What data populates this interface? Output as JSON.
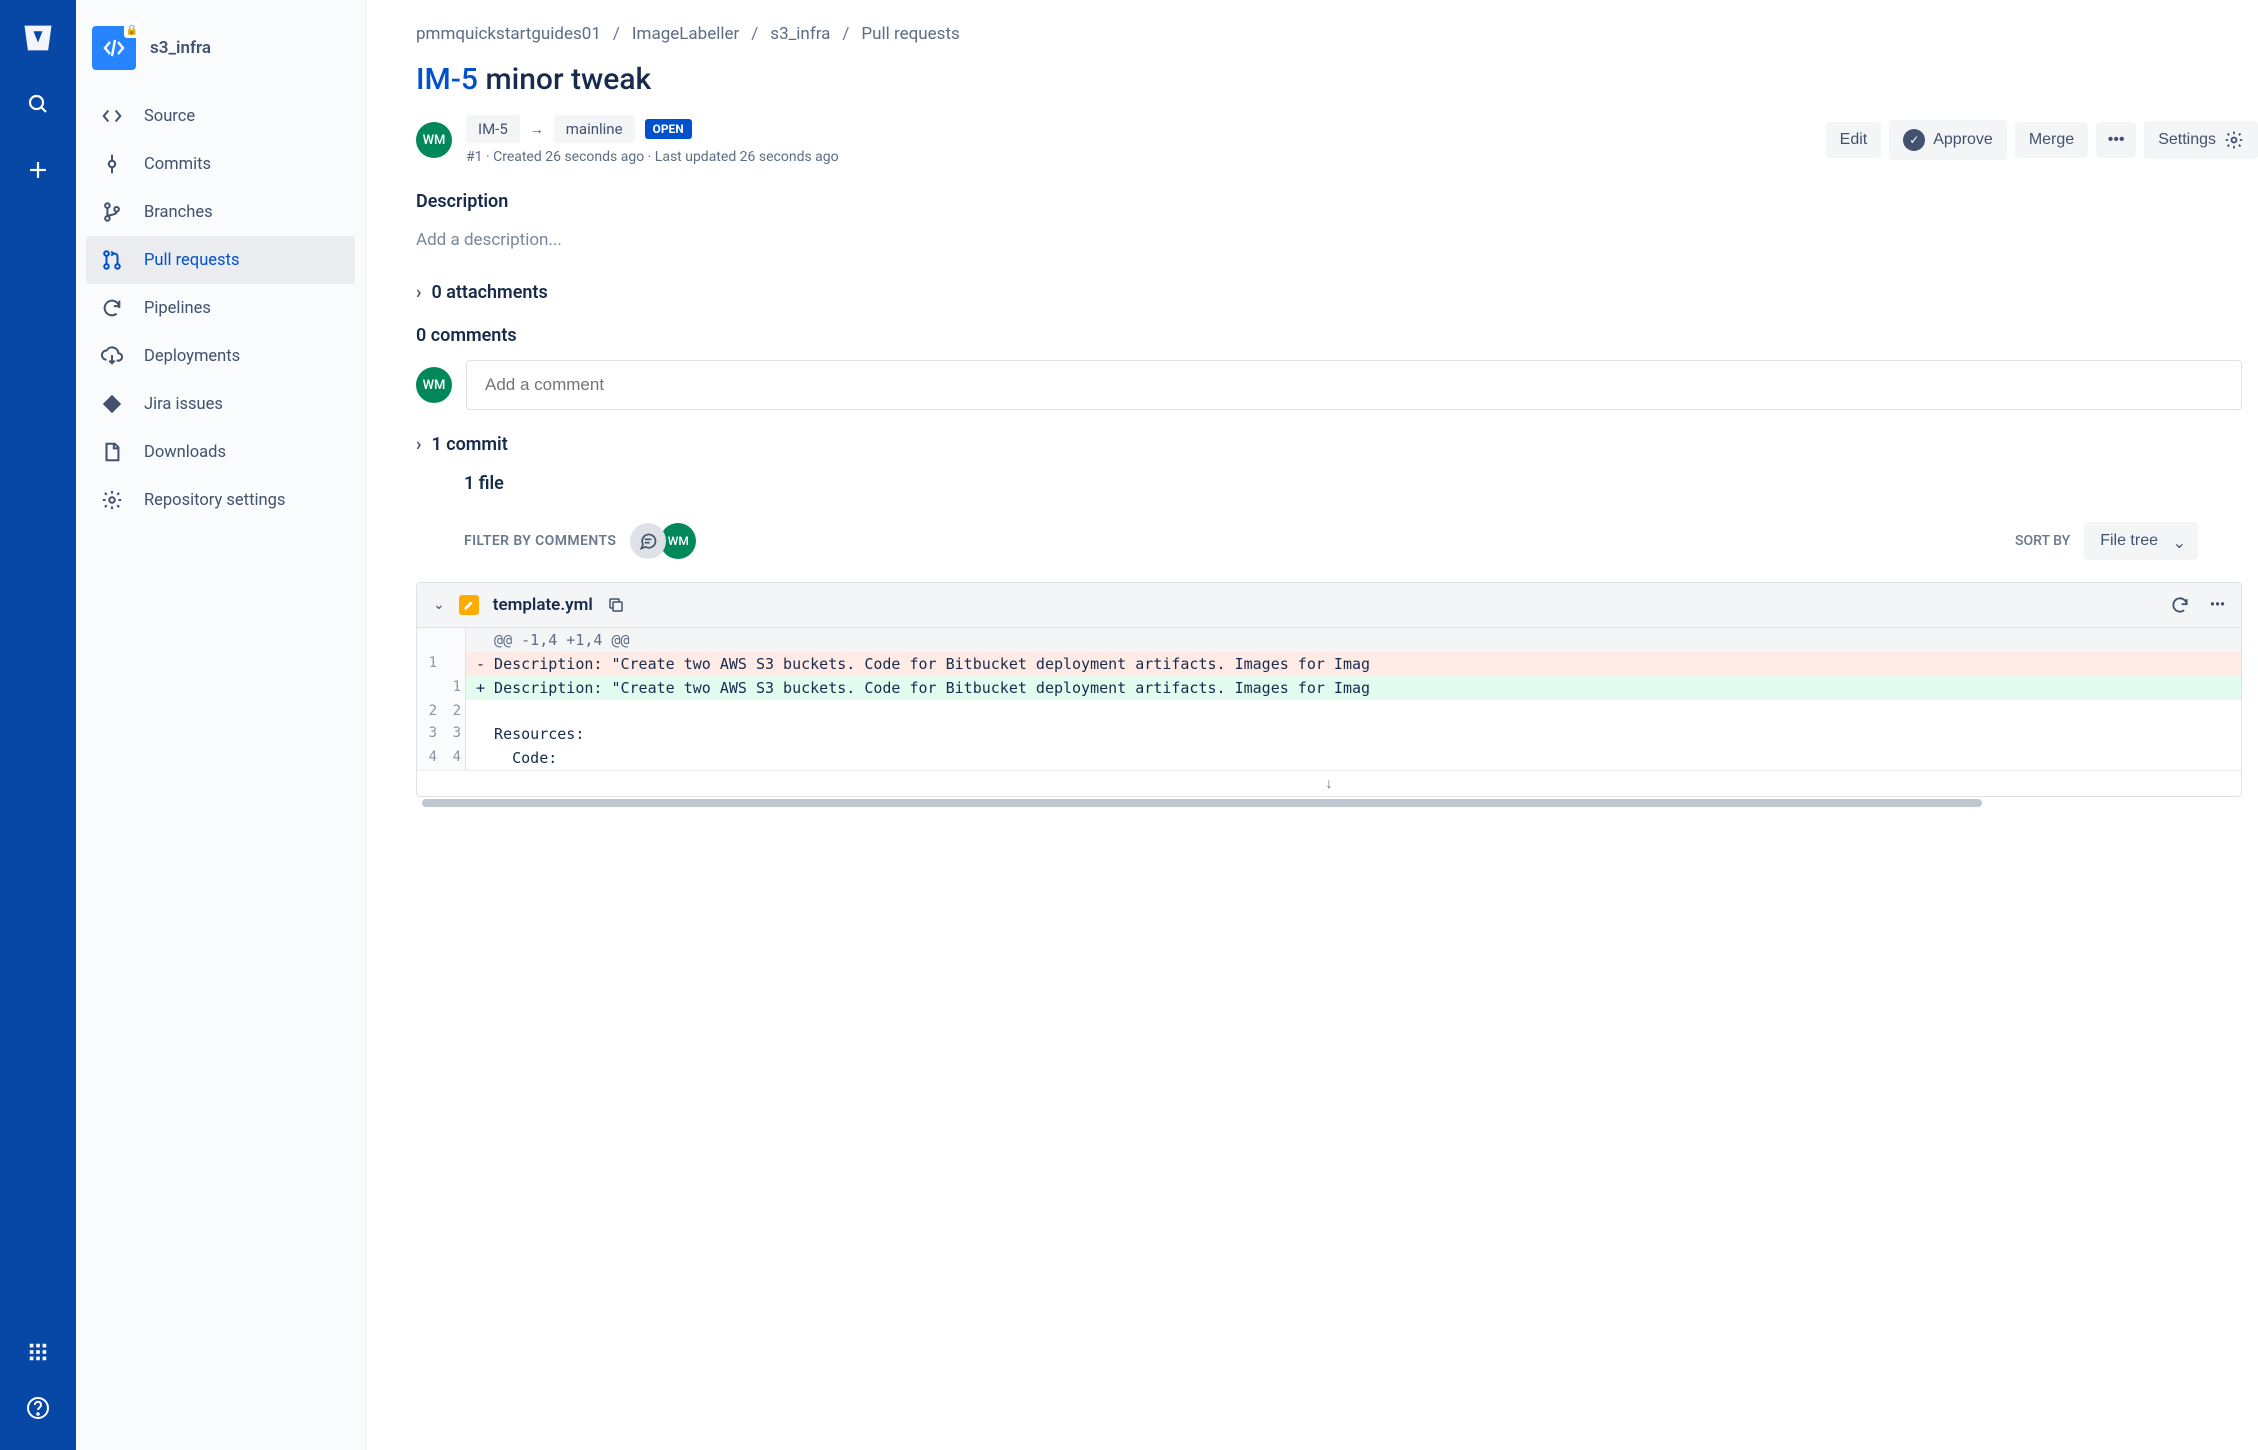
{
  "repo": {
    "name": "s3_infra"
  },
  "sidebar": {
    "items": [
      {
        "label": "Source"
      },
      {
        "label": "Commits"
      },
      {
        "label": "Branches"
      },
      {
        "label": "Pull requests"
      },
      {
        "label": "Pipelines"
      },
      {
        "label": "Deployments"
      },
      {
        "label": "Jira issues"
      },
      {
        "label": "Downloads"
      },
      {
        "label": "Repository settings"
      }
    ]
  },
  "breadcrumb": {
    "a": "pmmquickstartguides01",
    "b": "ImageLabeller",
    "c": "s3_infra",
    "d": "Pull requests"
  },
  "pr": {
    "issue_key": "IM-5",
    "title_rest": " minor tweak",
    "source_branch": "IM-5",
    "target_branch": "mainline",
    "status": "OPEN",
    "meta": "#1 · Created 26 seconds ago · Last updated 26 seconds ago",
    "author_initials": "WM"
  },
  "actions": {
    "edit": "Edit",
    "approve": "Approve",
    "merge": "Merge",
    "settings": "Settings"
  },
  "description": {
    "heading": "Description",
    "placeholder": "Add a description..."
  },
  "attachments": {
    "label": "0 attachments"
  },
  "comments": {
    "heading": "0 comments",
    "placeholder": "Add a comment",
    "avatar": "WM"
  },
  "commits": {
    "label": "1 commit"
  },
  "files": {
    "count_label": "1 file",
    "filter_label": "FILTER BY COMMENTS",
    "filter_avatar": "WM",
    "sort_label": "SORT BY",
    "sort_value": "File tree"
  },
  "diff": {
    "filename": "template.yml",
    "hunk": "@@ -1,4 +1,4 @@",
    "lines": [
      {
        "type": "del",
        "old": "1",
        "new": "",
        "text": "- Description: \"Create two AWS S3 buckets. Code for Bitbucket deployment artifacts. Images for Imag"
      },
      {
        "type": "add",
        "old": "",
        "new": "1",
        "text": "+ Description: \"Create two AWS S3 buckets. Code for Bitbucket deployment artifacts. Images for Imag"
      },
      {
        "type": "ctx",
        "old": "2",
        "new": "2",
        "text": ""
      },
      {
        "type": "ctx",
        "old": "3",
        "new": "3",
        "text": "  Resources:"
      },
      {
        "type": "ctx",
        "old": "4",
        "new": "4",
        "text": "    Code:"
      }
    ]
  }
}
